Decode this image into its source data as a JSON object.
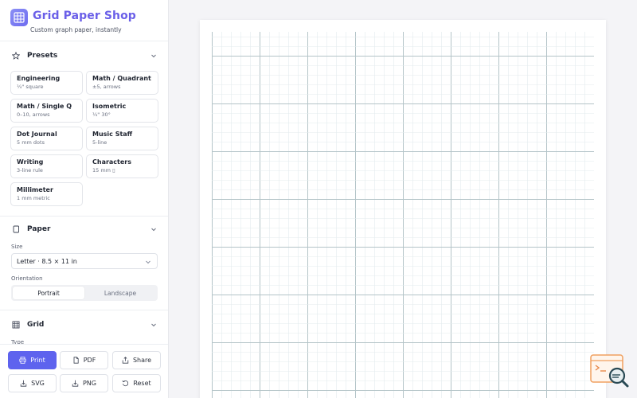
{
  "app": {
    "title": "Grid Paper Shop",
    "subtitle": "Custom graph paper, instantly",
    "accent": "#5e63ee"
  },
  "presets": {
    "title": "Presets",
    "icon": "star-icon",
    "items": [
      {
        "name": "Engineering",
        "desc": "¼\" square"
      },
      {
        "name": "Math / Quadrant",
        "desc": "±5, arrows"
      },
      {
        "name": "Math / Single Q",
        "desc": "0–10, arrows"
      },
      {
        "name": "Isometric",
        "desc": "¼\" 30°"
      },
      {
        "name": "Dot Journal",
        "desc": "5 mm dots"
      },
      {
        "name": "Music Staff",
        "desc": "5-line"
      },
      {
        "name": "Writing",
        "desc": "3-line rule"
      },
      {
        "name": "Characters",
        "desc": "15 mm ▯"
      },
      {
        "name": "Millimeter",
        "desc": "1 mm metric"
      }
    ]
  },
  "paper": {
    "title": "Paper",
    "size_label": "Size",
    "size_value": "Letter · 8.5 × 11 in",
    "orientation_label": "Orientation",
    "orientation_options": [
      "Portrait",
      "Landscape"
    ],
    "orientation_selected": "Portrait"
  },
  "grid": {
    "title": "Grid",
    "type_label": "Type"
  },
  "actions": {
    "print": "Print",
    "pdf": "PDF",
    "share": "Share",
    "svg": "SVG",
    "png": "PNG",
    "reset": "Reset"
  },
  "colors": {
    "minor_line": "#e3ebee",
    "major_line": "#b4c4c8"
  }
}
